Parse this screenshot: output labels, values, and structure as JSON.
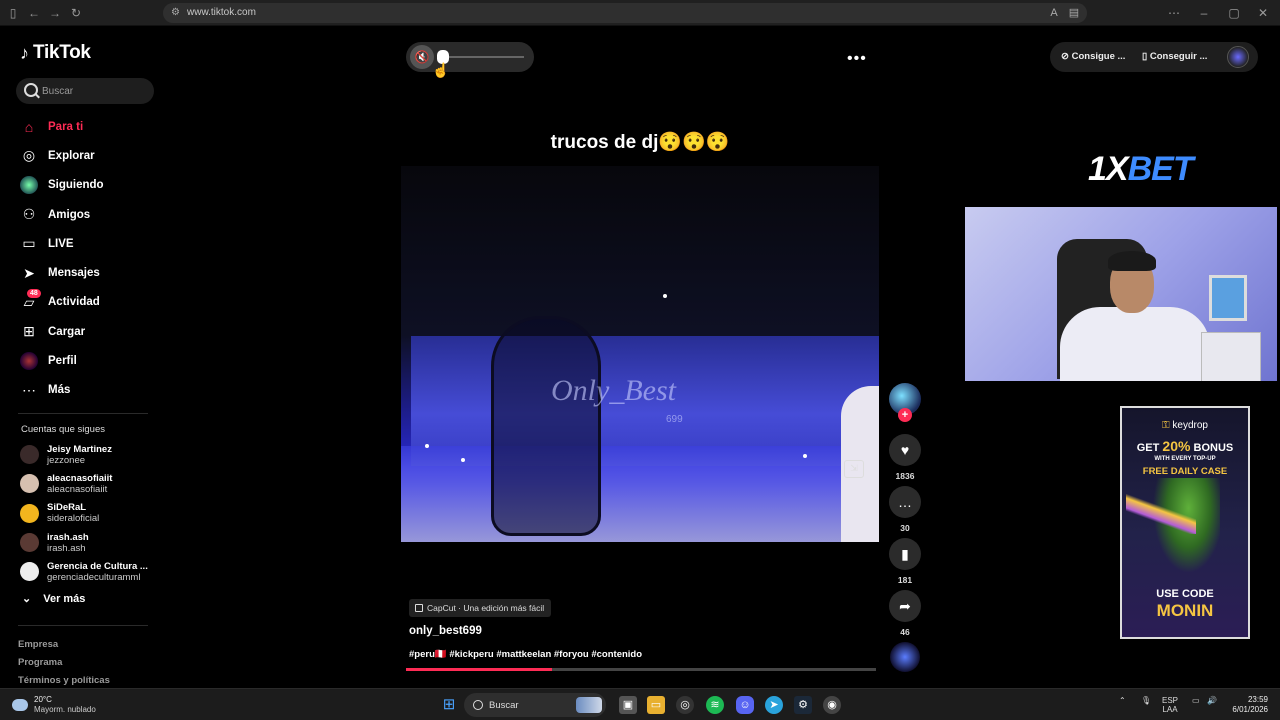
{
  "browser": {
    "url": "www.tiktok.com",
    "controls": [
      "sidebar-icon",
      "back-icon",
      "forward-icon",
      "reload-icon"
    ],
    "window_controls": [
      "more-icon",
      "minimize-icon",
      "restore-icon",
      "close-icon"
    ]
  },
  "sidebar": {
    "logo": "TikTok",
    "search_placeholder": "Buscar",
    "nav": [
      {
        "label": "Para ti",
        "icon": "home-icon",
        "active": true
      },
      {
        "label": "Explorar",
        "icon": "compass-icon"
      },
      {
        "label": "Siguiendo",
        "icon": "following-avatar-icon"
      },
      {
        "label": "Amigos",
        "icon": "friends-icon"
      },
      {
        "label": "LIVE",
        "icon": "live-icon"
      },
      {
        "label": "Mensajes",
        "icon": "paper-plane-icon"
      },
      {
        "label": "Actividad",
        "icon": "inbox-icon",
        "badge": "48"
      },
      {
        "label": "Cargar",
        "icon": "plus-square-icon"
      },
      {
        "label": "Perfil",
        "icon": "profile-avatar-icon"
      },
      {
        "label": "Más",
        "icon": "ellipsis-icon"
      }
    ],
    "following_title": "Cuentas que sigues",
    "following": [
      {
        "name": "Jeisy Martinez",
        "handle": "jezzonee",
        "color": "#3a2a2a"
      },
      {
        "name": "aleacnasofiaiit",
        "handle": "aleacnasofiaiit",
        "color": "#d6c0b0"
      },
      {
        "name": "SiDeRaL",
        "handle": "sideraloficial",
        "color": "#f2b51e"
      },
      {
        "name": "irash.ash",
        "handle": "irash.ash",
        "color": "#5a3a34"
      },
      {
        "name": "Gerencia de Cultura ...",
        "handle": "gerenciadeculturamml",
        "color": "#eeeeee"
      }
    ],
    "ver_mas": "Ver más",
    "footer": [
      "Empresa",
      "Programa",
      "Términos y políticas"
    ]
  },
  "video": {
    "caption": "trucos de dj😯😯😯",
    "watermark": "Only_Best",
    "watermark_num": "699",
    "capcut": "CapCut · Una edición más fácil",
    "author": "only_best699",
    "hashtags": "#peru🇵🇪 #kickperu #mattkeelan #foryou #contenido",
    "progress": 0.31,
    "volume": 0.0
  },
  "actions": {
    "likes": "1836",
    "comments": "30",
    "saves": "181",
    "shares": "46"
  },
  "topbar": {
    "btn1": "Consigue ...",
    "btn2": "Conseguir ..."
  },
  "overlays": {
    "brand_a": "1X",
    "brand_b": "BET",
    "kd_logo_a": "key",
    "kd_logo_b": "drop",
    "kd_get": "GET ",
    "kd_pct": "20%",
    "kd_bonus": " BONUS",
    "kd_every": "WITH EVERY TOP-UP",
    "kd_free": "FREE DAILY CASE",
    "kd_use": "USE CODE",
    "kd_code": "MONIN"
  },
  "taskbar": {
    "temp": "20°C",
    "weather": "Mayorm. nublado",
    "search": "Buscar",
    "lang1": "ESP",
    "lang2": "LAA",
    "time": "23:59",
    "date": "6/01/2026"
  }
}
